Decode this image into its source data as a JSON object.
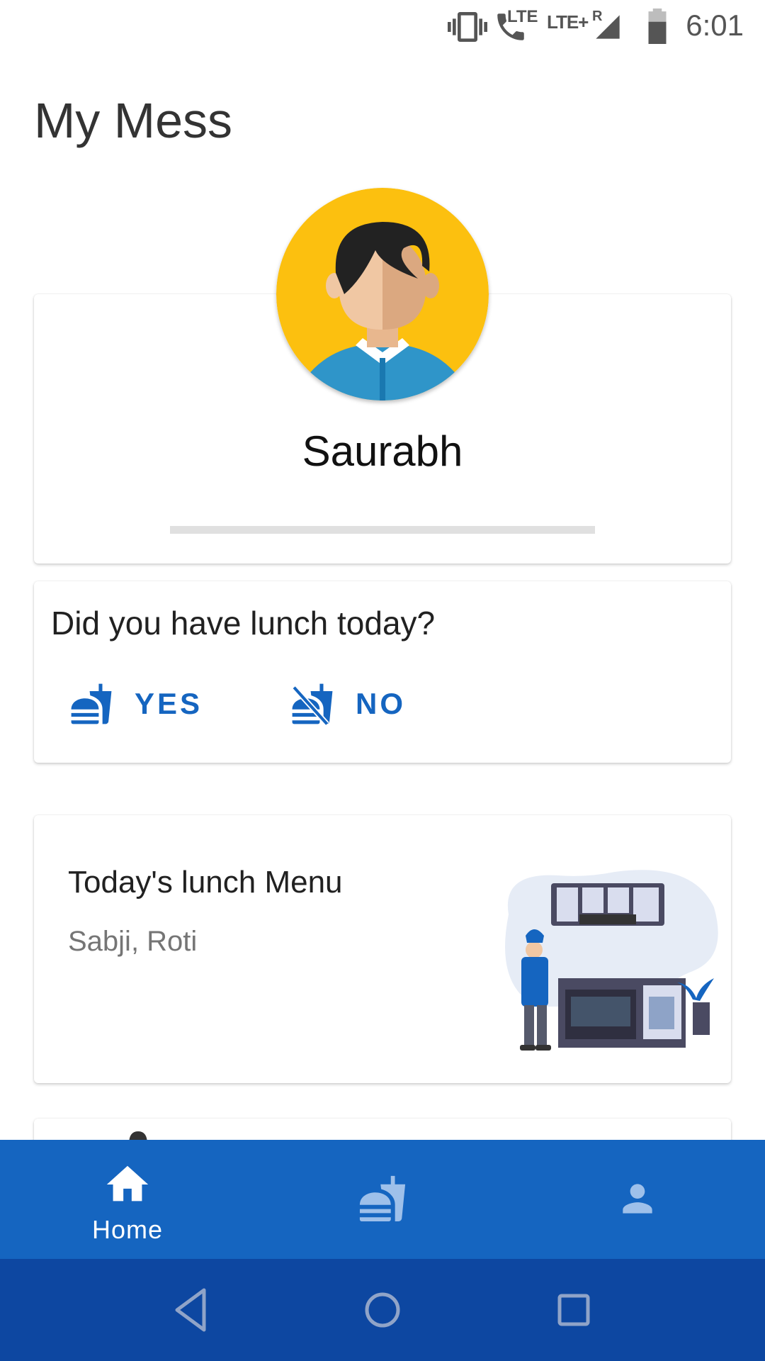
{
  "status_bar": {
    "time": "6:01",
    "network_label": "LTE",
    "network2_label": "LTE+",
    "roaming_label": "R"
  },
  "app": {
    "title": "My Mess"
  },
  "profile": {
    "name": "Saurabh",
    "progress": 0
  },
  "lunch_prompt": {
    "question": "Did you have lunch today?",
    "yes_label": "YES",
    "no_label": "NO"
  },
  "menu": {
    "title": "Today's lunch Menu",
    "items": "Sabji, Roti"
  },
  "bottom_nav": {
    "home_label": "Home"
  },
  "colors": {
    "primary": "#1565c0",
    "primary_dark": "#0d47a1",
    "avatar_bg": "#fcc00f"
  }
}
